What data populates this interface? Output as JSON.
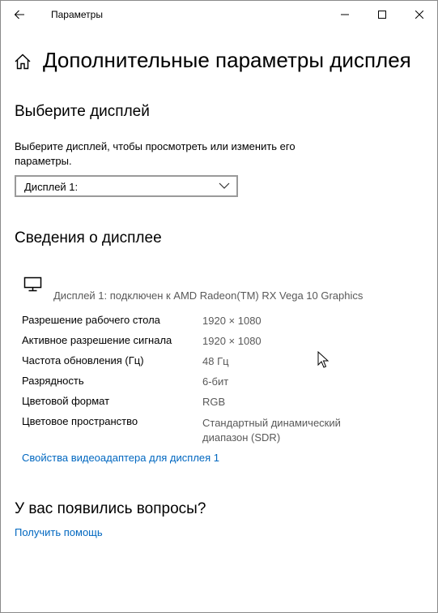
{
  "window": {
    "title": "Параметры"
  },
  "icons": {
    "back": "arrow-left-icon",
    "minimize": "minimize-icon",
    "maximize": "maximize-icon",
    "close": "close-icon",
    "home": "home-icon",
    "monitor": "monitor-icon",
    "chevron": "chevron-down-icon",
    "cursor": "mouse-pointer-icon"
  },
  "header": {
    "title": "Дополнительные параметры дисплея"
  },
  "select_display": {
    "heading": "Выберите дисплей",
    "description": "Выберите дисплей, чтобы просмотреть или изменить его параметры.",
    "dropdown_value": "Дисплей 1:"
  },
  "display_info": {
    "heading": "Сведения о дисплее",
    "connection": "Дисплей 1: подключен к AMD Radeon(TM) RX Vega 10 Graphics",
    "properties": [
      {
        "label": "Разрешение рабочего стола",
        "value": "1920 × 1080"
      },
      {
        "label": "Активное разрешение сигнала",
        "value": "1920 × 1080"
      },
      {
        "label": "Частота обновления (Гц)",
        "value": "48 Гц"
      },
      {
        "label": "Разрядность",
        "value": "6-бит"
      },
      {
        "label": "Цветовой формат",
        "value": "RGB"
      },
      {
        "label": "Цветовое пространство",
        "value": "Стандартный динамический диапазон (SDR)"
      }
    ],
    "adapter_link": "Свойства видеоадаптера для дисплея 1"
  },
  "help": {
    "heading": "У вас появились вопросы?",
    "link": "Получить помощь"
  },
  "colors": {
    "link": "#0067c0",
    "secondary_text": "#595959",
    "border": "#9a9a9a"
  }
}
